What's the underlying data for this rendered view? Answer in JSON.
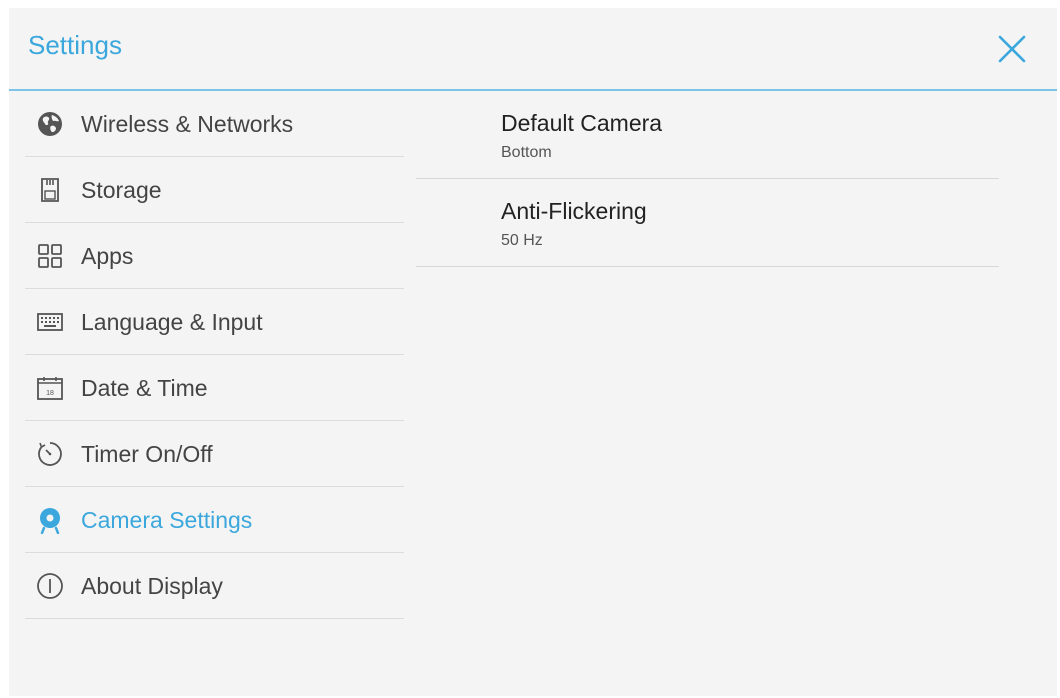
{
  "header": {
    "title": "Settings",
    "close_icon": "close-icon"
  },
  "colors": {
    "accent": "#3ba7dc",
    "divider_accent": "#7cc4e8",
    "background": "#f4f4f4",
    "text_primary": "#222222",
    "text_secondary": "#555555"
  },
  "sidebar": {
    "items": [
      {
        "label": "Wireless & Networks",
        "icon": "globe-icon",
        "active": false
      },
      {
        "label": "Storage",
        "icon": "sd-card-icon",
        "active": false
      },
      {
        "label": "Apps",
        "icon": "apps-grid-icon",
        "active": false
      },
      {
        "label": "Language & Input",
        "icon": "keyboard-icon",
        "active": false
      },
      {
        "label": "Date & Time",
        "icon": "calendar-icon",
        "active": false
      },
      {
        "label": "Timer On/Off",
        "icon": "timer-icon",
        "active": false
      },
      {
        "label": "Camera Settings",
        "icon": "camera-icon",
        "active": true
      },
      {
        "label": "About Display",
        "icon": "info-icon",
        "active": false
      }
    ]
  },
  "content": {
    "settings": [
      {
        "title": "Default Camera",
        "value": "Bottom"
      },
      {
        "title": "Anti-Flickering",
        "value": "50 Hz"
      }
    ]
  },
  "icon_text": {
    "calendar_day": "18"
  }
}
